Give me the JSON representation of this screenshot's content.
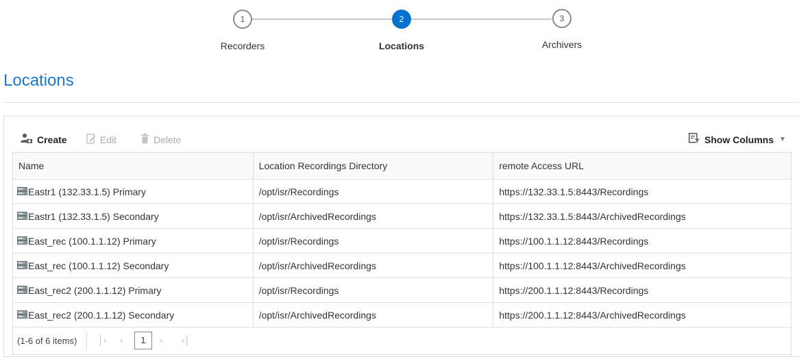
{
  "wizard": {
    "steps": [
      {
        "number": "1",
        "label": "Recorders"
      },
      {
        "number": "2",
        "label": "Locations"
      },
      {
        "number": "3",
        "label": "Archivers"
      }
    ],
    "active_step": 2
  },
  "page": {
    "title": "Locations"
  },
  "toolbar": {
    "create_label": "Create",
    "edit_label": "Edit",
    "delete_label": "Delete",
    "show_columns_label": "Show Columns"
  },
  "table": {
    "headers": [
      "Name",
      "Location Recordings Directory",
      "remote Access URL"
    ],
    "rows": [
      [
        "Eastr1 (132.33.1.5) Primary",
        "/opt/isr/Recordings",
        "https://132.33.1.5:8443/Recordings"
      ],
      [
        "Eastr1 (132.33.1.5) Secondary",
        "/opt/isr/ArchivedRecordings",
        "https://132.33.1.5:8443/ArchivedRecordings"
      ],
      [
        "East_rec (100.1.1.12) Primary",
        "/opt/isr/Recordings",
        "https://100.1.1.12:8443/Recordings"
      ],
      [
        "East_rec (100.1.1.12) Secondary",
        "/opt/isr/ArchivedRecordings",
        "https://100.1.1.12:8443/ArchivedRecordings"
      ],
      [
        "East_rec2 (200.1.1.12) Primary",
        "/opt/isr/Recordings",
        "https://200.1.1.12:8443/Recordings"
      ],
      [
        "East_rec2 (200.1.1.12) Secondary",
        "/opt/isr/ArchivedRecordings",
        "https://200.1.1.12:8443/ArchivedRecordings"
      ]
    ]
  },
  "pager": {
    "info": "(1-6 of 6 items)",
    "current_page": "1"
  },
  "colors": {
    "accent": "#0572ce",
    "title": "#1b78c8",
    "disabled": "#aaaaaa"
  },
  "icons": {
    "create": "add-user-icon",
    "edit": "pencil-icon",
    "delete": "trash-icon",
    "show_columns": "columns-filter-icon",
    "row": "server-icon"
  }
}
